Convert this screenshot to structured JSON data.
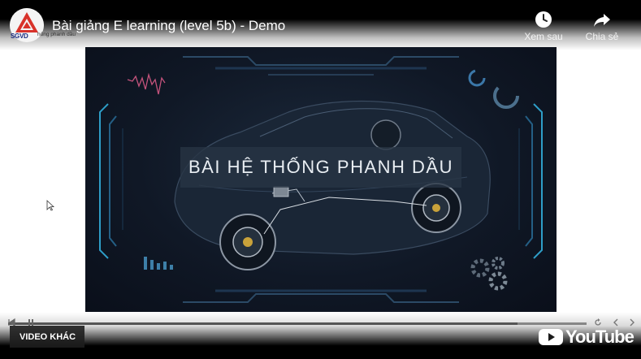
{
  "channel": {
    "logo_text": "SGVD",
    "sub_text": "hống phanh dầu"
  },
  "video": {
    "title": "Bài giảng E learning (level 5b) - Demo"
  },
  "top_actions": {
    "watch_later_label": "Xem sau",
    "share_label": "Chia sẻ"
  },
  "slide": {
    "title": "BÀI HỆ THỐNG PHANH DẦU"
  },
  "controls": {
    "progress": 0.88,
    "more_videos_label": "VIDEO KHÁC",
    "brand_label": "YouTube"
  },
  "icons": {
    "watch_later": "clock-icon",
    "share": "share-arrow-icon",
    "brand": "youtube-play-icon"
  },
  "colors": {
    "brand_red": "#e62117",
    "slide_bg": "#101826",
    "accent_cyan": "#2e9ec8"
  }
}
